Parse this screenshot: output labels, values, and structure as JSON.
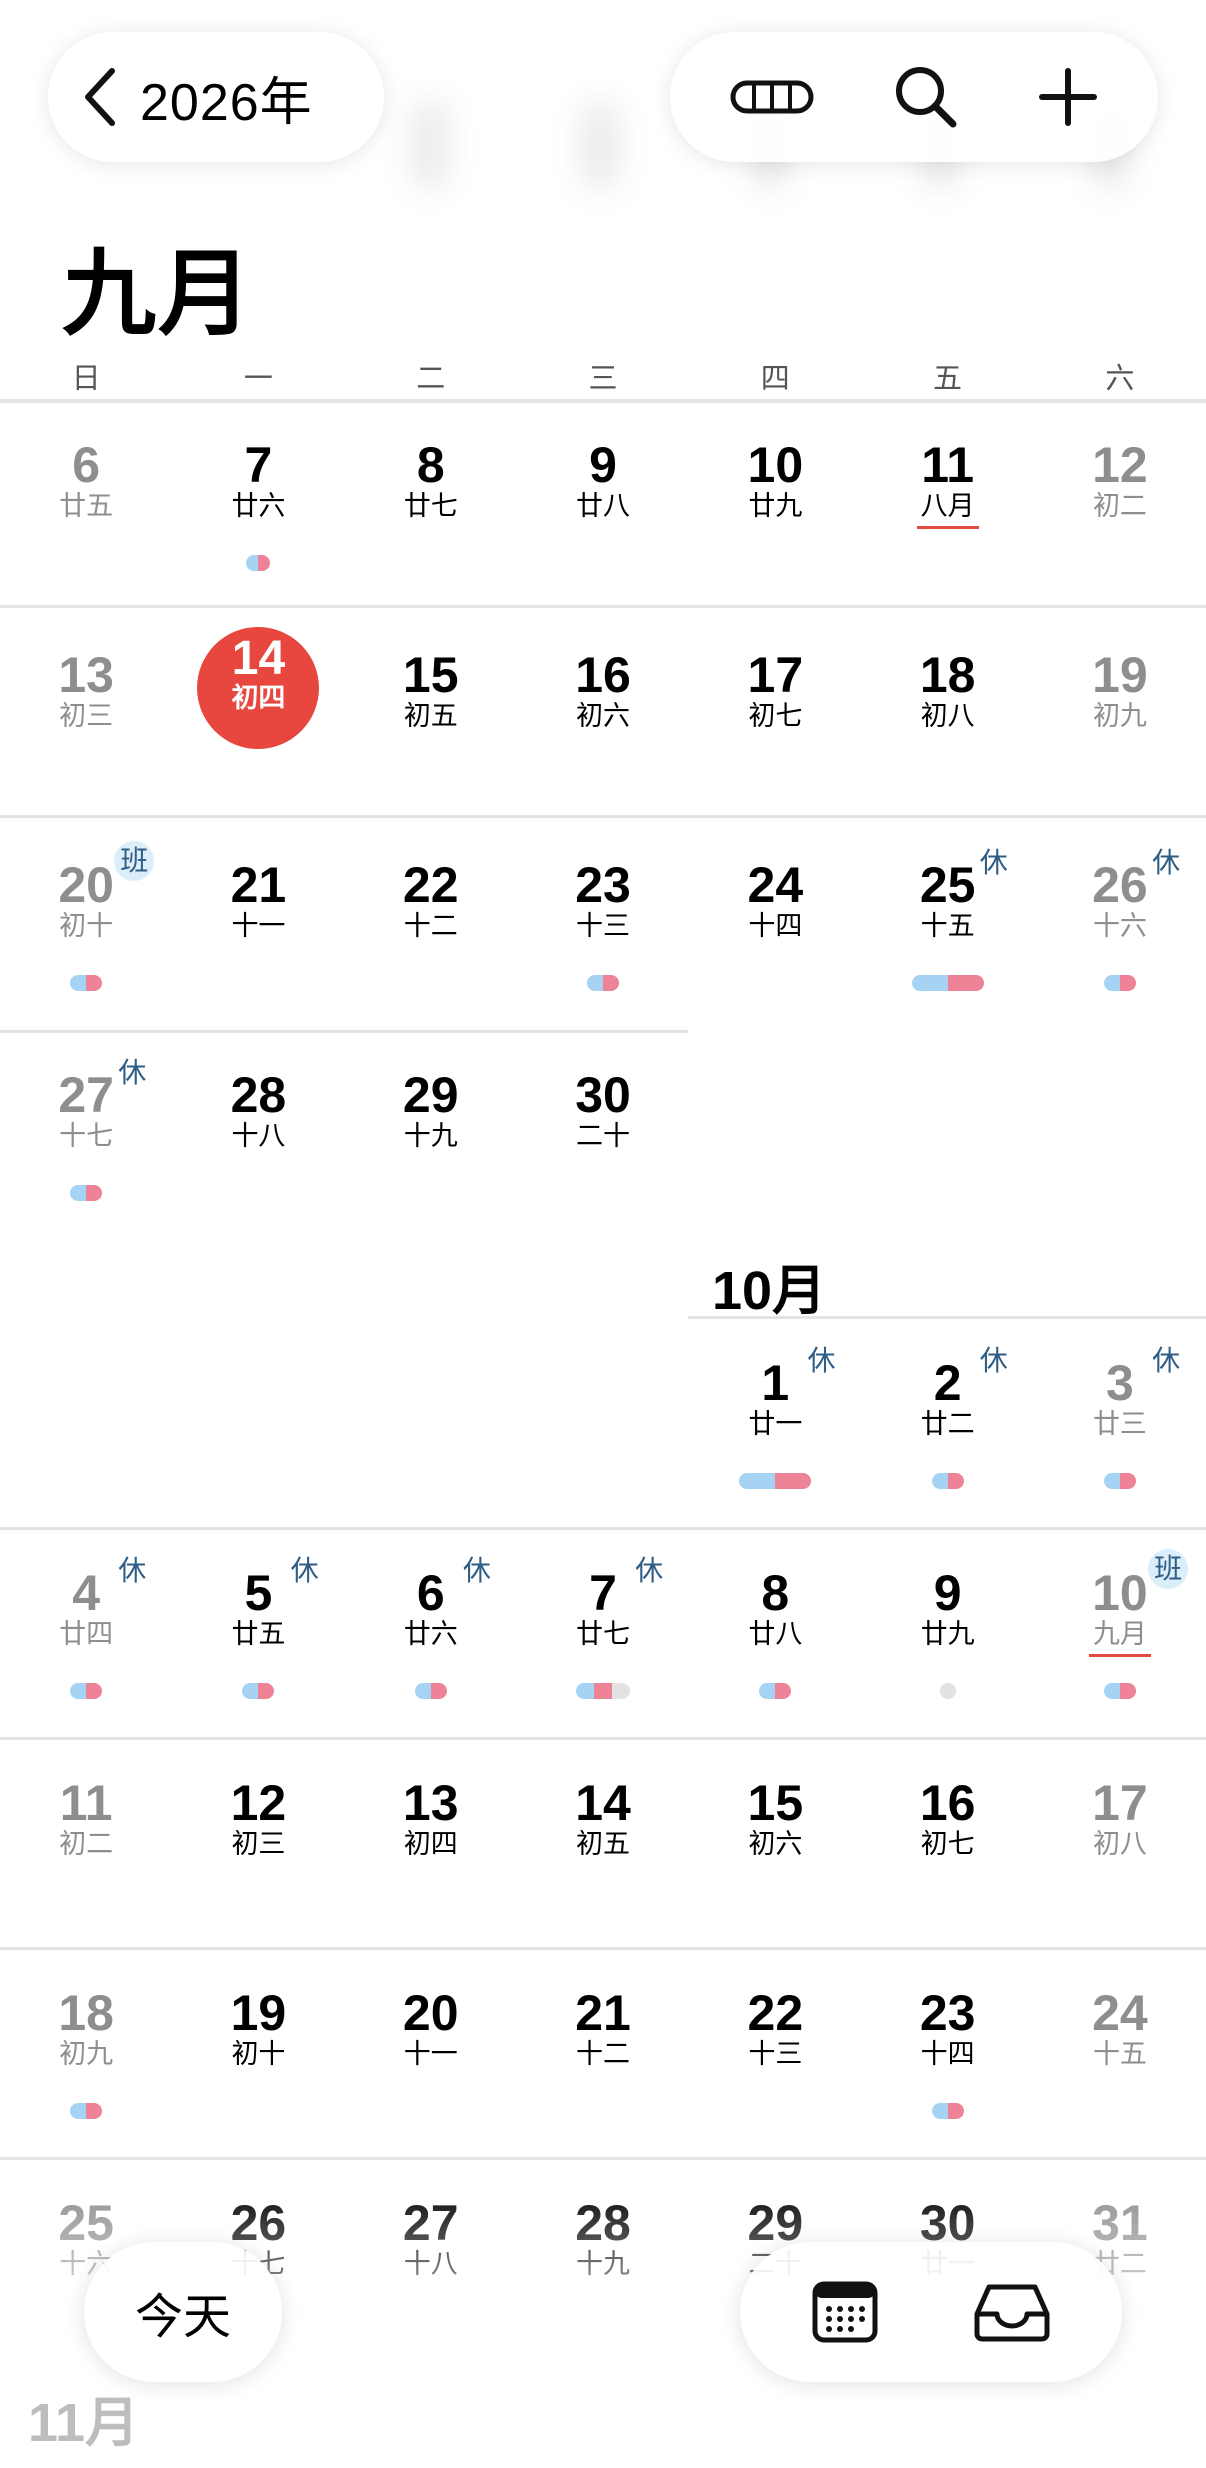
{
  "header": {
    "back_label": "2026年",
    "actions": [
      "view-toggle-icon",
      "search-icon",
      "plus-icon"
    ]
  },
  "month_title": "九月",
  "october_title": "10月",
  "november_title": "11月",
  "weekdays": [
    "日",
    "一",
    "二",
    "三",
    "四",
    "五",
    "六"
  ],
  "bottom": {
    "today_label": "今天",
    "tools": [
      "calendar-grid-icon",
      "inbox-icon"
    ]
  },
  "colors": {
    "today": "#e8473f",
    "rest_tag": "#2f5d86",
    "blue_event": "#a6d2f3",
    "pink_event": "#ee8296"
  },
  "weeks": [
    [
      {
        "d": "6",
        "l": "廿五"
      },
      {
        "d": "7",
        "l": "廿六"
      },
      {
        "d": "8",
        "l": "廿七"
      },
      {
        "d": "9",
        "l": "廿八"
      },
      {
        "d": "10",
        "l": "廿九"
      },
      {
        "d": "11",
        "l": "八月"
      },
      {
        "d": "12",
        "l": "初二"
      }
    ],
    [
      {
        "d": "13",
        "l": "初三"
      },
      {
        "d": "14",
        "l": "初四"
      },
      {
        "d": "15",
        "l": "初五"
      },
      {
        "d": "16",
        "l": "初六"
      },
      {
        "d": "17",
        "l": "初七"
      },
      {
        "d": "18",
        "l": "初八"
      },
      {
        "d": "19",
        "l": "初九"
      }
    ],
    [
      {
        "d": "20",
        "l": "初十",
        "t": "班"
      },
      {
        "d": "21",
        "l": "十一"
      },
      {
        "d": "22",
        "l": "十二"
      },
      {
        "d": "23",
        "l": "十三"
      },
      {
        "d": "24",
        "l": "十四"
      },
      {
        "d": "25",
        "l": "十五",
        "t": "休"
      },
      {
        "d": "26",
        "l": "十六",
        "t": "休"
      }
    ],
    [
      {
        "d": "27",
        "l": "十七",
        "t": "休"
      },
      {
        "d": "28",
        "l": "十八"
      },
      {
        "d": "29",
        "l": "十九"
      },
      {
        "d": "30",
        "l": "二十"
      }
    ],
    [
      {
        "d": "1",
        "l": "廿一",
        "t": "休"
      },
      {
        "d": "2",
        "l": "廿二",
        "t": "休"
      },
      {
        "d": "3",
        "l": "廿三",
        "t": "休"
      }
    ],
    [
      {
        "d": "4",
        "l": "廿四",
        "t": "休"
      },
      {
        "d": "5",
        "l": "廿五",
        "t": "休"
      },
      {
        "d": "6",
        "l": "廿六",
        "t": "休"
      },
      {
        "d": "7",
        "l": "廿七",
        "t": "休"
      },
      {
        "d": "8",
        "l": "廿八"
      },
      {
        "d": "9",
        "l": "廿九"
      },
      {
        "d": "10",
        "l": "九月",
        "t": "班"
      }
    ],
    [
      {
        "d": "11",
        "l": "初二"
      },
      {
        "d": "12",
        "l": "初三"
      },
      {
        "d": "13",
        "l": "初四"
      },
      {
        "d": "14",
        "l": "初五"
      },
      {
        "d": "15",
        "l": "初六"
      },
      {
        "d": "16",
        "l": "初七"
      },
      {
        "d": "17",
        "l": "初八"
      }
    ],
    [
      {
        "d": "18",
        "l": "初九"
      },
      {
        "d": "19",
        "l": "初十"
      },
      {
        "d": "20",
        "l": "十一"
      },
      {
        "d": "21",
        "l": "十二"
      },
      {
        "d": "22",
        "l": "十三"
      },
      {
        "d": "23",
        "l": "十四"
      },
      {
        "d": "24",
        "l": "十五"
      }
    ],
    [
      {
        "d": "25",
        "l": "十六"
      },
      {
        "d": "26",
        "l": "十七"
      },
      {
        "d": "27",
        "l": "十八"
      },
      {
        "d": "28",
        "l": "十九"
      },
      {
        "d": "29",
        "l": "二十"
      },
      {
        "d": "30",
        "l": "廿一"
      },
      {
        "d": "31",
        "l": "廿二"
      }
    ]
  ]
}
